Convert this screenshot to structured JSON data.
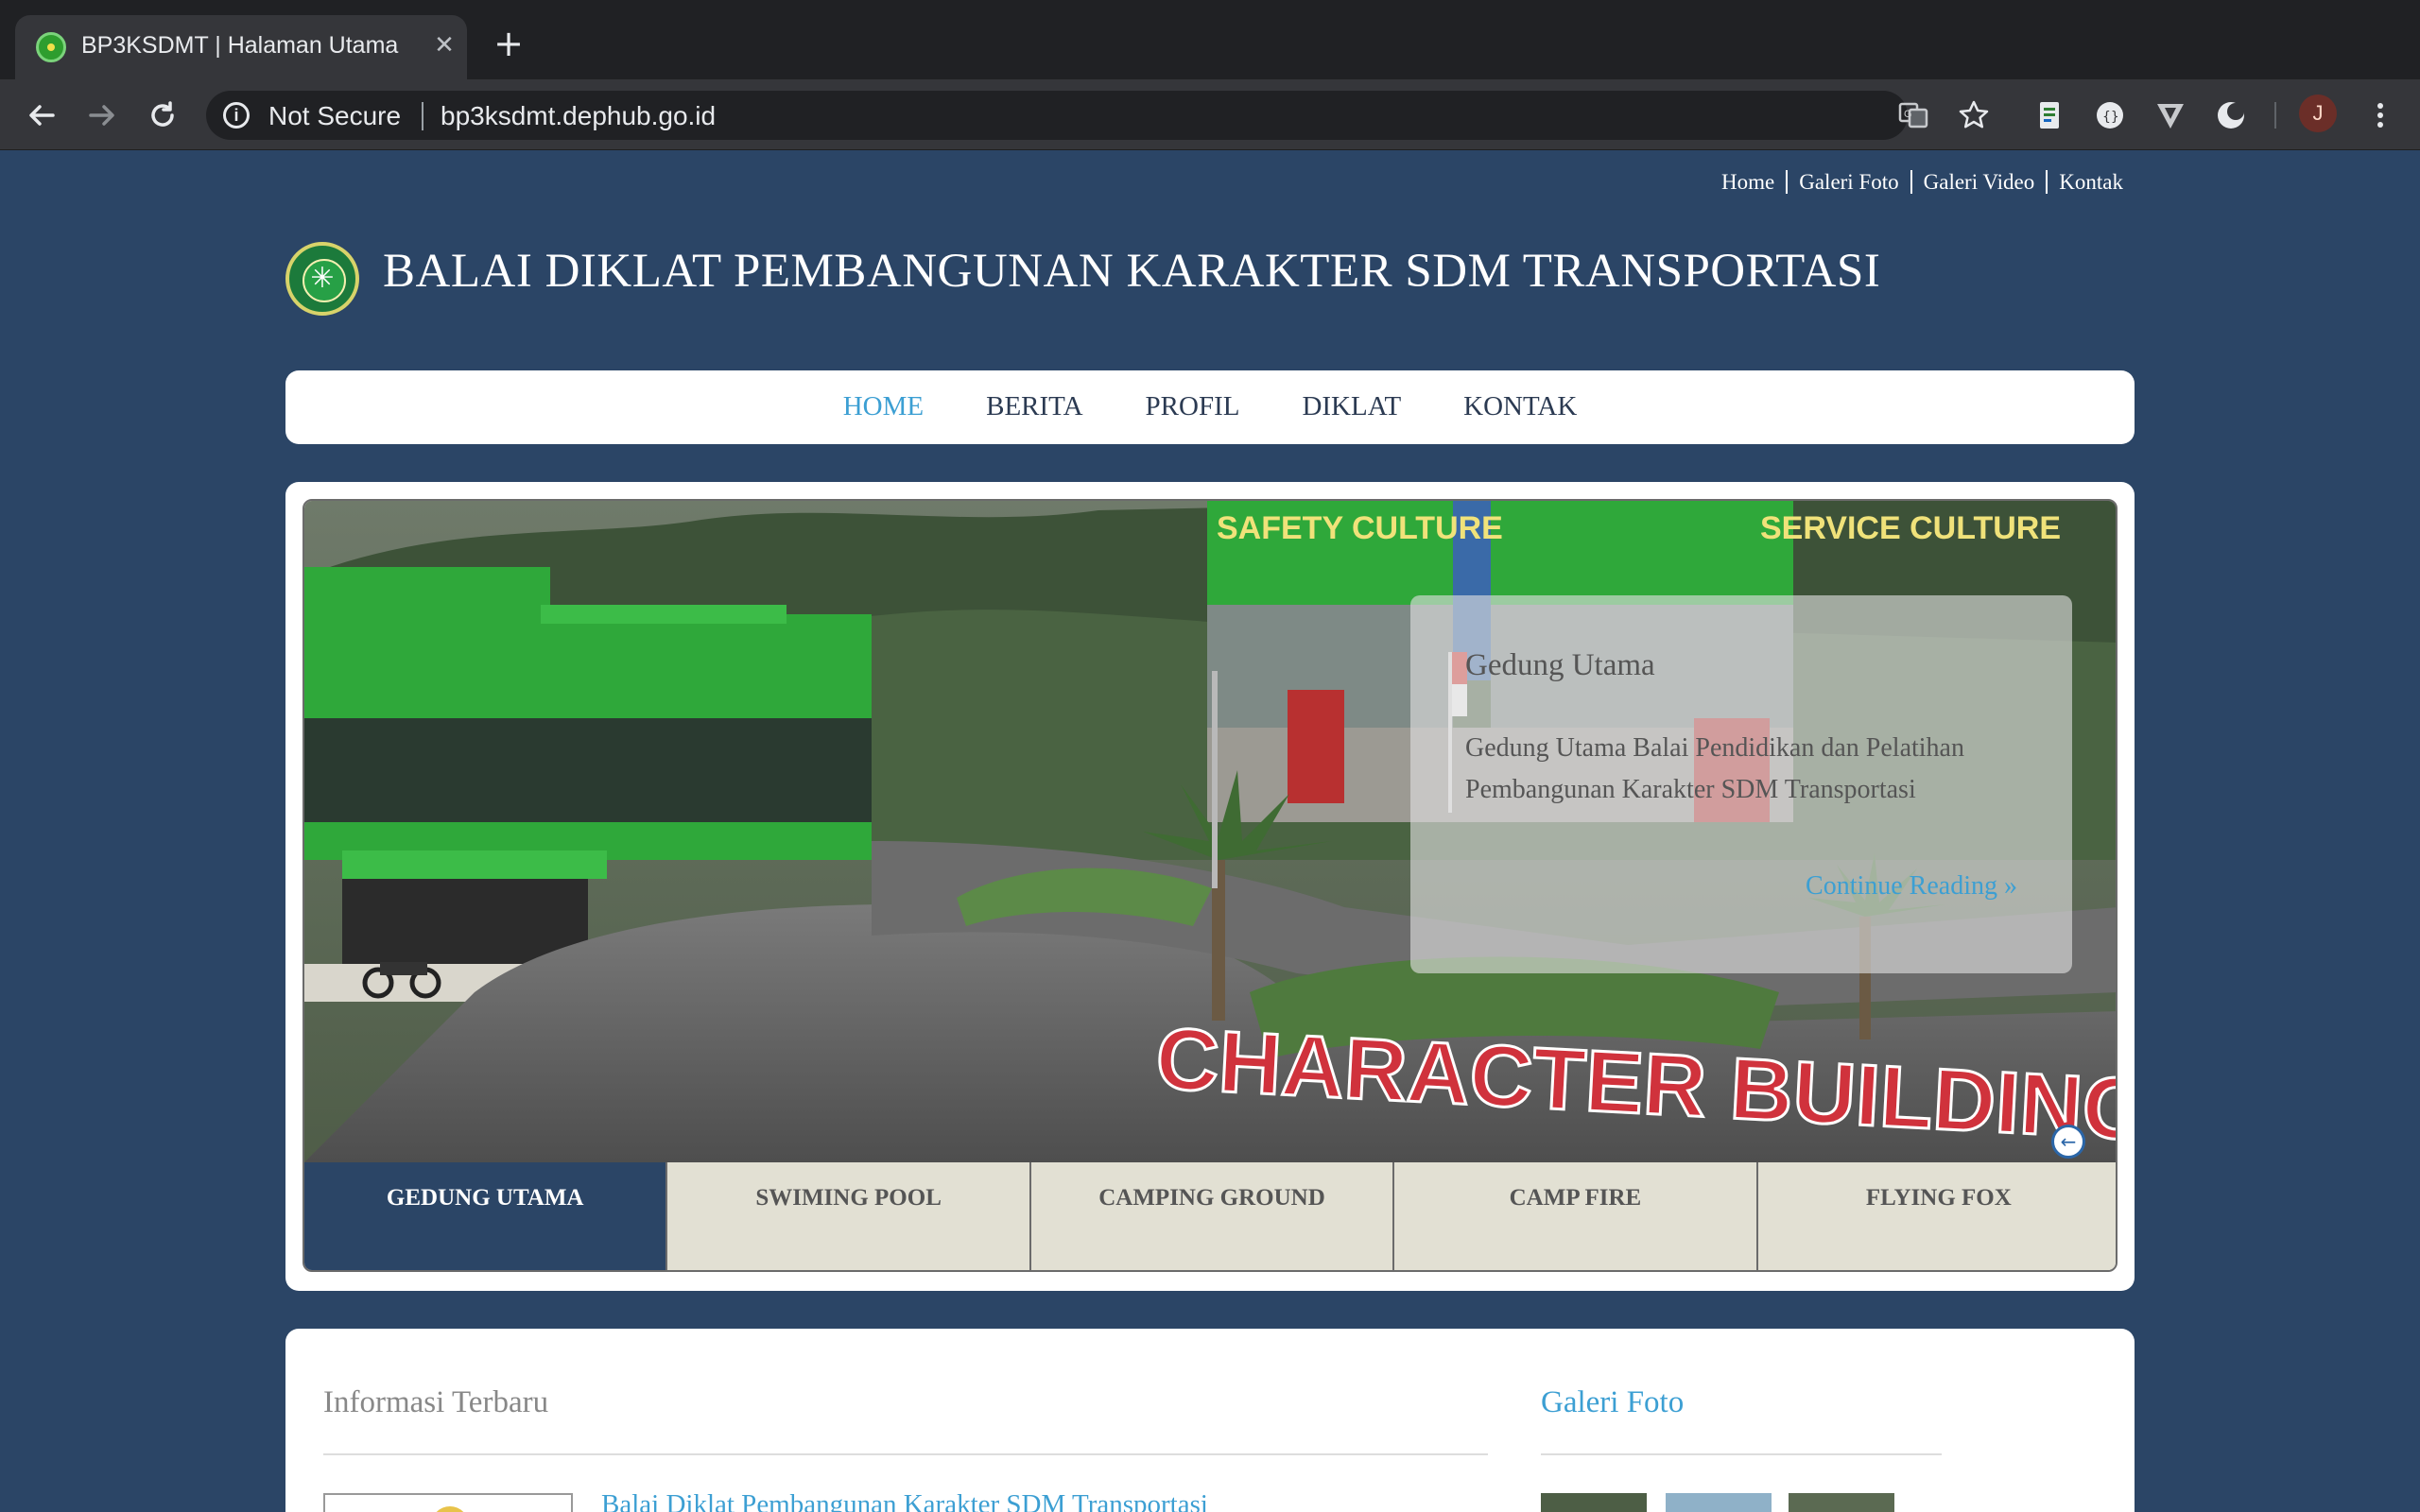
{
  "browser": {
    "tab_title": "BP3KSDMT | Halaman Utama",
    "security_label": "Not Secure",
    "url": "bp3ksdmt.dephub.go.id",
    "profile_initial": "J"
  },
  "top_links": [
    "Home",
    "Galeri Foto",
    "Galeri Video",
    "Kontak"
  ],
  "site": {
    "title": "BALAI DIKLAT PEMBANGUNAN KARAKTER SDM TRANSPORTASI"
  },
  "main_nav": [
    {
      "label": "HOME",
      "active": true
    },
    {
      "label": "BERITA",
      "active": false
    },
    {
      "label": "PROFIL",
      "active": false
    },
    {
      "label": "DIKLAT",
      "active": false
    },
    {
      "label": "KONTAK",
      "active": false
    }
  ],
  "slider": {
    "signs": [
      "SAFETY CULTURE",
      "SERVICE CULTURE",
      "CHARACTER BUILDING"
    ],
    "caption": {
      "title": "Gedung Utama",
      "text": "Gedung Utama Balai Pendidikan dan Pelatihan Pembangunan Karakter SDM Transportasi",
      "more": "Continue Reading »"
    },
    "tabs": [
      "GEDUNG UTAMA",
      "SWIMING POOL",
      "CAMPING GROUND",
      "CAMP FIRE",
      "FLYING FOX"
    ],
    "active_tab": 0
  },
  "sections": {
    "latest_info_title": "Informasi Terbaru",
    "gallery_title": "Galeri Foto",
    "latest_news_headline": "Balai Diklat Pembangunan Karakter SDM Transportasi"
  },
  "colors": {
    "page_bg": "#2b4566",
    "accent": "#3c9fd3",
    "tab_bg": "#e2e0d3"
  }
}
